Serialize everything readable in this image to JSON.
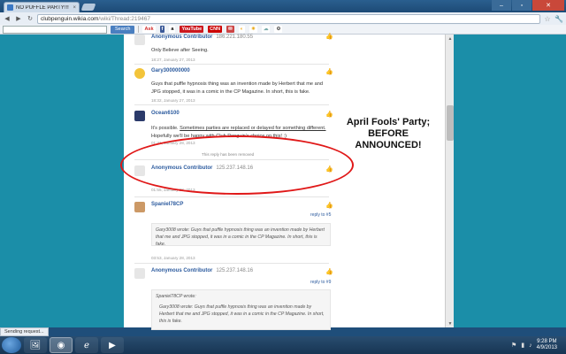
{
  "browser": {
    "tab_title": "NO PUFFLE PARTY!!! -",
    "tab_close": "×",
    "url_host": "clubpenguin.wikia.com",
    "url_path": "/wiki/Thread:219467",
    "window_controls": [
      "–",
      "▫",
      "✕"
    ],
    "back": "◀",
    "forward": "▶",
    "reload": "↻",
    "star": "☆",
    "wrench": "🔧"
  },
  "toolbar": {
    "search_placeholder": "",
    "search_button": "Search",
    "items": [
      {
        "label": "Ask",
        "color": "#d12a2a",
        "bg": "#ffffff"
      },
      {
        "label": "f",
        "color": "#ffffff",
        "bg": "#3b5998"
      },
      {
        "label": "a",
        "color": "#000000",
        "bg": "#ffffff"
      },
      {
        "label": "YouTube",
        "color": "#ffffff",
        "bg": "#cc181e"
      },
      {
        "label": "CNN",
        "color": "#ffffff",
        "bg": "#cc0000"
      },
      {
        "label": "✉",
        "color": "#ffffff",
        "bg": "#c44"
      },
      {
        "label": "◐",
        "color": "#f0a000",
        "bg": "#ffffff"
      },
      {
        "label": "☀",
        "color": "#e8a000",
        "bg": "#ffffff"
      },
      {
        "label": "☁",
        "color": "#7aa",
        "bg": "#ffffff"
      },
      {
        "label": "⚙",
        "color": "#555",
        "bg": "#ffffff"
      }
    ]
  },
  "posts": [
    {
      "name": "Anonymous Contributor",
      "ip": "186.221.180.55",
      "body": "Only Believe after Seeing.",
      "time": "18:27, January 27, 2013"
    },
    {
      "name": "Gary300000000",
      "ip": "",
      "body": "Guys that puffle hypnosis thing was an invention made by Herbert that me and JPG stopped, it was in a comic in the CP Magazine. In short, this is fake.",
      "time": "18:32, January 27, 2013"
    },
    {
      "name": "Ocean6100",
      "ip": "",
      "body_pre": "It's possible. ",
      "body_link": "Sometimes parties are replaced or delayed for something different.",
      "body_post": " Hopefully we'll be happy with Club Penguin's choice on this! :)",
      "time": "01:41, January 28, 2013"
    },
    {
      "removed": "This reply has been removed"
    },
    {
      "name": "Anonymous Contributor",
      "ip": "125.237.148.16",
      "time": "01:55, January 28, 2013"
    },
    {
      "name": "Spaniel78CP",
      "reply_to": "reply to #5",
      "quote": "Gary3008 wrote: Guys that puffle hypnosis thing was an invention made by Herbert that me and JPG stopped, it was in a comic in the CP Magazine. In short, this is fake.",
      "time": "03:53, January 28, 2013"
    },
    {
      "name": "Anonymous Contributor",
      "ip": "125.237.148.16",
      "reply_to": "reply to #9",
      "quote_head": "Spaniel78CP wrote:",
      "quote_inner": "Gary3008 wrote: Guys that puffle hypnosis thing was an invention made by Herbert that me and JPG stopped, it was in a comic in the CP Magazine. In short, this is fake."
    }
  ],
  "annotation": "April Fools' Party; BEFORE ANNOUNCED!",
  "status_text": "Sending request...",
  "taskbar": {
    "time": "9:28 PM",
    "date": "4/9/2013"
  }
}
